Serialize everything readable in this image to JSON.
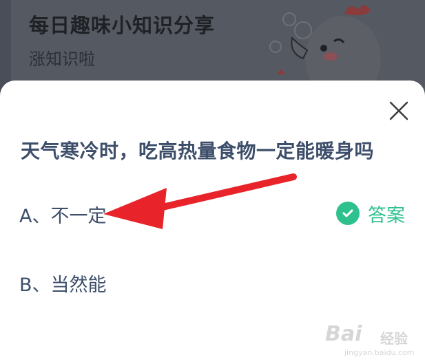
{
  "banner": {
    "title": "每日趣味小知识分享",
    "subtitle": "涨知识啦"
  },
  "quiz": {
    "question": "天气寒冷时，吃高热量食物一定能暖身吗",
    "options": [
      {
        "label": "A、不一定"
      },
      {
        "label": "B、当然能"
      }
    ],
    "answer_label": "答案"
  },
  "watermark": {
    "brand": "Bai",
    "brand_suffix": "经验",
    "url": "jingyan.baidu.com"
  },
  "colors": {
    "accent_green": "#2ec18e",
    "text_blue": "#3d4e6b",
    "arrow_red": "#e8242a",
    "overlay": "#4a4e58"
  },
  "icons": [
    "close-icon",
    "check-icon",
    "mascot-illustration",
    "red-arrow-annotation"
  ]
}
